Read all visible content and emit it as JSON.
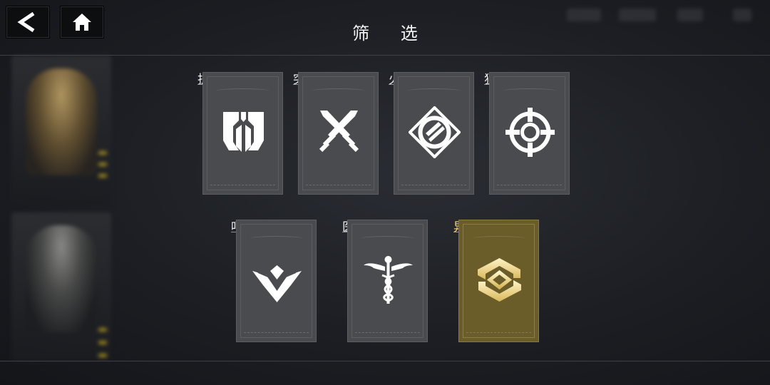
{
  "header": {
    "title": "筛 选"
  },
  "nav": {
    "back_icon": "back-arrow-icon",
    "home_icon": "home-icon"
  },
  "filters": [
    {
      "label": "护卫",
      "icon": "guard-helmet-icon",
      "selected": false
    },
    {
      "label": "突击",
      "icon": "crossed-swords-icon",
      "selected": false
    },
    {
      "label": "火力",
      "icon": "firepower-diamond-icon",
      "selected": false
    },
    {
      "label": "狙击",
      "icon": "crosshair-icon",
      "selected": false
    },
    {
      "label": "哨兵",
      "icon": "sentinel-wings-icon",
      "selected": false
    },
    {
      "label": "医疗",
      "icon": "caduceus-icon",
      "selected": false
    },
    {
      "label": "异能",
      "icon": "psionic-hexagon-icon",
      "selected": true
    }
  ],
  "colors": {
    "accent": "#f0d774",
    "card": "#4a4b4e",
    "card_selected": "#6a5d2a"
  }
}
